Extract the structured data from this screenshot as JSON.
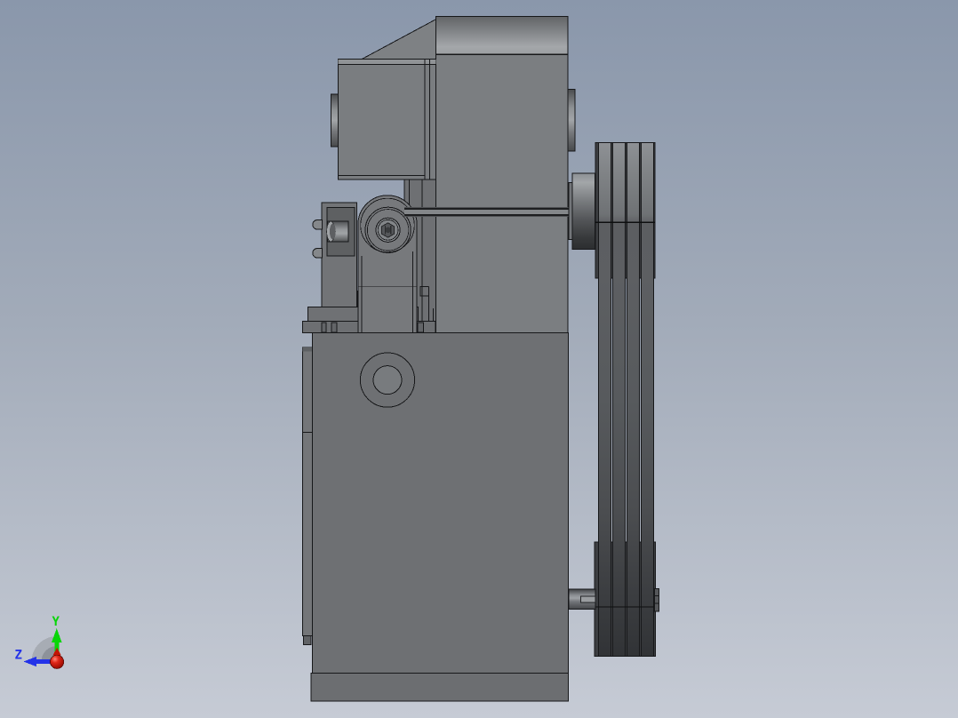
{
  "viewport": {
    "background_top": "#8a97ab",
    "background_bottom": "#c6cbd5"
  },
  "model": {
    "outline_color": "#17181a",
    "upper_housing_fill": "#7b7e81",
    "left_housing_fill": "#7a7d80",
    "gusset_fill": "#7e8184",
    "arm_fill": "#77797c",
    "bracket_fill": "#727477",
    "pocket_fill": "#5e6062",
    "pedestal_fill": "#6f7174",
    "behind_block_fill": "#6e7073",
    "body_fill": "#6e7073",
    "base_fill": "#6c6e71",
    "side_strip_fill": "#747679",
    "rod_fill": "#84878a",
    "pulley_dark_fill": "#3c3e41",
    "keyway_fill": "#9a9da0",
    "washer_fill": "#828588",
    "boss_fill": "#787b7e"
  },
  "triad": {
    "y_axis_label": "Y",
    "z_axis_label": "Z",
    "y_axis_color": "#08d508",
    "z_axis_color": "#2433e8",
    "x_axis_color": "#c41404",
    "fan_outer_color": "#a7acb4",
    "fan_inner_color": "#8d929a"
  }
}
